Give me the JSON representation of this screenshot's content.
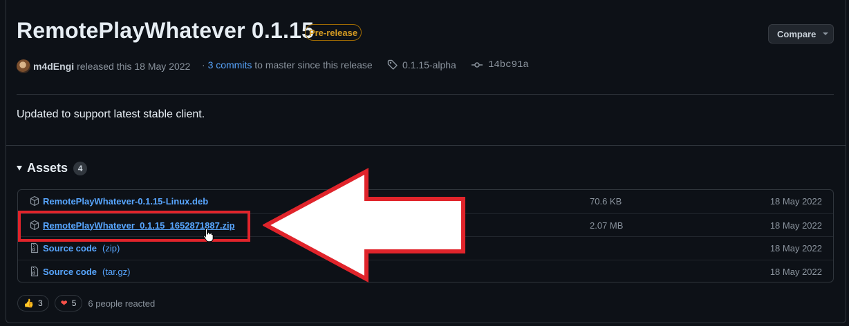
{
  "release": {
    "title": "RemotePlayWhatever 0.1.15",
    "badge": "Pre-release",
    "compare_label": "Compare",
    "author": "m4dEngi",
    "released_text": "released this 18 May 2022",
    "commits_prefix": "·",
    "commits_link": "3 commits",
    "commits_suffix": "to master since this release",
    "tag": "0.1.15-alpha",
    "commit": "14bc91a",
    "body": "Updated to support latest stable client."
  },
  "assets": {
    "heading": "Assets",
    "count": "4",
    "rows": [
      {
        "name": "RemotePlayWhatever-0.1.15-Linux.deb",
        "ext": "",
        "size": "70.6 KB",
        "date": "18 May 2022",
        "icon": "package-icon"
      },
      {
        "name": "RemotePlayWhatever_0.1.15_1652871887.zip",
        "ext": "",
        "size": "2.07 MB",
        "date": "18 May 2022",
        "icon": "package-icon"
      },
      {
        "name": "Source code",
        "ext": "(zip)",
        "size": "",
        "date": "18 May 2022",
        "icon": "file-zip-icon"
      },
      {
        "name": "Source code",
        "ext": "(tar.gz)",
        "size": "",
        "date": "18 May 2022",
        "icon": "file-zip-icon"
      }
    ]
  },
  "reactions": {
    "thumbs_count": "3",
    "heart_count": "5",
    "summary": "6 people reacted"
  },
  "colors": {
    "background": "#0d1117",
    "link": "#58a6ff",
    "prerelease": "#d29922",
    "annotation": "#e0242b"
  }
}
